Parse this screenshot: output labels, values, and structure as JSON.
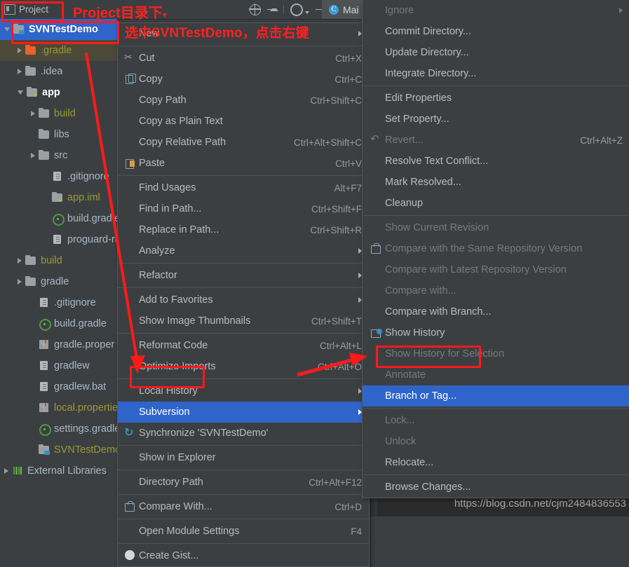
{
  "header": {
    "project_tab_label": "Project",
    "project_tab_icon": "project-tool-window-icon",
    "toolbar_icons": [
      "locate-target-icon",
      "collapse-all-icon",
      "settings-gear-icon",
      "hide-window-icon"
    ],
    "editor_tab_label": "Mai",
    "editor_tab_icon": "java-class-icon"
  },
  "annotations": {
    "title_note": "Project目录下",
    "title_caret": "▾",
    "select_note": "选中SVNTestDemo，点击右键",
    "boxes": [
      "project-tab",
      "svntestdemo-node",
      "subversion-item",
      "branch-or-tag-item"
    ],
    "color": "#ff1a1a"
  },
  "tree": {
    "items": [
      {
        "label": "SVNTestDemo",
        "indent": 0,
        "arrow": "down",
        "icon": "folder-module-svn-icon",
        "style": "root-selected"
      },
      {
        "label": ".gradle",
        "indent": 1,
        "arrow": "right",
        "icon": "folder-orange-icon",
        "style": "excluded"
      },
      {
        "label": ".idea",
        "indent": 1,
        "arrow": "right",
        "icon": "folder-grey-icon",
        "style": "normal"
      },
      {
        "label": "app",
        "indent": 1,
        "arrow": "down",
        "icon": "folder-module-icon",
        "style": "bold"
      },
      {
        "label": "build",
        "indent": 2,
        "arrow": "right",
        "icon": "folder-grey-icon",
        "style": "excluded"
      },
      {
        "label": "libs",
        "indent": 2,
        "arrow": "none",
        "icon": "folder-grey-icon",
        "style": "normal"
      },
      {
        "label": "src",
        "indent": 2,
        "arrow": "right",
        "icon": "folder-grey-icon",
        "style": "normal"
      },
      {
        "label": ".gitignore",
        "indent": 3,
        "arrow": "none",
        "icon": "file-text-icon",
        "style": "normal"
      },
      {
        "label": "app.iml",
        "indent": 3,
        "arrow": "none",
        "icon": "module-iml-icon",
        "style": "excluded"
      },
      {
        "label": "build.gradle",
        "indent": 3,
        "arrow": "none",
        "icon": "gradle-file-icon",
        "style": "normal"
      },
      {
        "label": "proguard-ru",
        "indent": 3,
        "arrow": "none",
        "icon": "file-text-icon",
        "style": "normal"
      },
      {
        "label": "build",
        "indent": 1,
        "arrow": "right",
        "icon": "folder-grey-icon",
        "style": "excluded"
      },
      {
        "label": "gradle",
        "indent": 1,
        "arrow": "right",
        "icon": "folder-grey-icon",
        "style": "normal"
      },
      {
        "label": ".gitignore",
        "indent": 2,
        "arrow": "none",
        "icon": "file-text-icon",
        "style": "normal"
      },
      {
        "label": "build.gradle",
        "indent": 2,
        "arrow": "none",
        "icon": "gradle-file-icon",
        "style": "normal"
      },
      {
        "label": "gradle.proper",
        "indent": 2,
        "arrow": "none",
        "icon": "properties-file-icon",
        "style": "normal"
      },
      {
        "label": "gradlew",
        "indent": 2,
        "arrow": "none",
        "icon": "file-text-icon",
        "style": "normal"
      },
      {
        "label": "gradlew.bat",
        "indent": 2,
        "arrow": "none",
        "icon": "file-text-icon",
        "style": "normal"
      },
      {
        "label": "local.propertie",
        "indent": 2,
        "arrow": "none",
        "icon": "properties-file-icon",
        "style": "excluded"
      },
      {
        "label": "settings.gradle",
        "indent": 2,
        "arrow": "none",
        "icon": "gradle-file-icon",
        "style": "normal"
      },
      {
        "label": "SVNTestDemo",
        "indent": 2,
        "arrow": "none",
        "icon": "folder-svn-icon",
        "style": "excluded"
      },
      {
        "label": "External Libraries",
        "indent": 0,
        "arrow": "right",
        "icon": "external-libraries-icon",
        "style": "normal"
      }
    ]
  },
  "context_menu": {
    "items": [
      {
        "label": "New",
        "accel": "",
        "icon": "",
        "submenu": true,
        "state": "normal"
      },
      {
        "sep": true
      },
      {
        "label": "Cut",
        "accel": "Ctrl+X",
        "icon": "cut-icon",
        "submenu": false,
        "state": "normal"
      },
      {
        "label": "Copy",
        "accel": "Ctrl+C",
        "icon": "copy-icon",
        "submenu": false,
        "state": "normal"
      },
      {
        "label": "Copy Path",
        "accel": "Ctrl+Shift+C",
        "icon": "",
        "submenu": false,
        "state": "normal"
      },
      {
        "label": "Copy as Plain Text",
        "accel": "",
        "icon": "",
        "submenu": false,
        "state": "normal"
      },
      {
        "label": "Copy Relative Path",
        "accel": "Ctrl+Alt+Shift+C",
        "icon": "",
        "submenu": false,
        "state": "normal"
      },
      {
        "label": "Paste",
        "accel": "Ctrl+V",
        "icon": "paste-icon",
        "submenu": false,
        "state": "normal"
      },
      {
        "sep": true
      },
      {
        "label": "Find Usages",
        "accel": "Alt+F7",
        "icon": "",
        "submenu": false,
        "state": "normal"
      },
      {
        "label": "Find in Path...",
        "accel": "Ctrl+Shift+F",
        "icon": "",
        "submenu": false,
        "state": "normal"
      },
      {
        "label": "Replace in Path...",
        "accel": "Ctrl+Shift+R",
        "icon": "",
        "submenu": false,
        "state": "normal"
      },
      {
        "label": "Analyze",
        "accel": "",
        "icon": "",
        "submenu": true,
        "state": "normal"
      },
      {
        "sep": true
      },
      {
        "label": "Refactor",
        "accel": "",
        "icon": "",
        "submenu": true,
        "state": "normal"
      },
      {
        "sep": true
      },
      {
        "label": "Add to Favorites",
        "accel": "",
        "icon": "",
        "submenu": true,
        "state": "normal"
      },
      {
        "label": "Show Image Thumbnails",
        "accel": "Ctrl+Shift+T",
        "icon": "",
        "submenu": false,
        "state": "normal"
      },
      {
        "sep": true
      },
      {
        "label": "Reformat Code",
        "accel": "Ctrl+Alt+L",
        "icon": "",
        "submenu": false,
        "state": "normal"
      },
      {
        "label": "Optimize Imports",
        "accel": "Ctrl+Alt+O",
        "icon": "",
        "submenu": false,
        "state": "normal"
      },
      {
        "sep": true
      },
      {
        "label": "Local History",
        "accel": "",
        "icon": "",
        "submenu": true,
        "state": "normal"
      },
      {
        "label": "Subversion",
        "accel": "",
        "icon": "",
        "submenu": true,
        "state": "selected"
      },
      {
        "label": "Synchronize 'SVNTestDemo'",
        "accel": "",
        "icon": "synchronize-icon",
        "submenu": false,
        "state": "normal"
      },
      {
        "sep": true
      },
      {
        "label": "Show in Explorer",
        "accel": "",
        "icon": "",
        "submenu": false,
        "state": "normal"
      },
      {
        "sep": true
      },
      {
        "label": "Directory Path",
        "accel": "Ctrl+Alt+F12",
        "icon": "",
        "submenu": false,
        "state": "normal"
      },
      {
        "sep": true
      },
      {
        "label": "Compare With...",
        "accel": "Ctrl+D",
        "icon": "compare-icon",
        "submenu": false,
        "state": "normal"
      },
      {
        "sep": true
      },
      {
        "label": "Open Module Settings",
        "accel": "F4",
        "icon": "",
        "submenu": false,
        "state": "normal"
      },
      {
        "sep": true
      },
      {
        "label": "Create Gist...",
        "accel": "",
        "icon": "github-icon",
        "submenu": false,
        "state": "normal"
      }
    ]
  },
  "submenu": {
    "title": "Subversion",
    "items": [
      {
        "label": "Ignore",
        "accel": "",
        "icon": "",
        "submenu": true,
        "state": "disabled"
      },
      {
        "label": "Commit Directory...",
        "accel": "",
        "icon": "",
        "submenu": false,
        "state": "normal"
      },
      {
        "label": "Update Directory...",
        "accel": "",
        "icon": "",
        "submenu": false,
        "state": "normal"
      },
      {
        "label": "Integrate Directory...",
        "accel": "",
        "icon": "",
        "submenu": false,
        "state": "normal"
      },
      {
        "sep": true
      },
      {
        "label": "Edit Properties",
        "accel": "",
        "icon": "",
        "submenu": false,
        "state": "normal"
      },
      {
        "label": "Set Property...",
        "accel": "",
        "icon": "",
        "submenu": false,
        "state": "normal"
      },
      {
        "label": "Revert...",
        "accel": "Ctrl+Alt+Z",
        "icon": "revert-icon",
        "submenu": false,
        "state": "disabled"
      },
      {
        "label": "Resolve Text Conflict...",
        "accel": "",
        "icon": "",
        "submenu": false,
        "state": "normal"
      },
      {
        "label": "Mark Resolved...",
        "accel": "",
        "icon": "",
        "submenu": false,
        "state": "normal"
      },
      {
        "label": "Cleanup",
        "accel": "",
        "icon": "",
        "submenu": false,
        "state": "normal"
      },
      {
        "sep": true
      },
      {
        "label": "Show Current Revision",
        "accel": "",
        "icon": "",
        "submenu": false,
        "state": "disabled"
      },
      {
        "label": "Compare with the Same Repository Version",
        "accel": "",
        "icon": "compare-icon",
        "submenu": false,
        "state": "disabled"
      },
      {
        "label": "Compare with Latest Repository Version",
        "accel": "",
        "icon": "",
        "submenu": false,
        "state": "disabled"
      },
      {
        "label": "Compare with...",
        "accel": "",
        "icon": "",
        "submenu": false,
        "state": "disabled"
      },
      {
        "label": "Compare with Branch...",
        "accel": "",
        "icon": "",
        "submenu": false,
        "state": "normal"
      },
      {
        "label": "Show History",
        "accel": "",
        "icon": "history-icon",
        "submenu": false,
        "state": "normal"
      },
      {
        "label": "Show History for Selection",
        "accel": "",
        "icon": "",
        "submenu": false,
        "state": "disabled"
      },
      {
        "label": "Annotate",
        "accel": "",
        "icon": "",
        "submenu": false,
        "state": "disabled"
      },
      {
        "label": "Branch or Tag...",
        "accel": "",
        "icon": "",
        "submenu": false,
        "state": "selected"
      },
      {
        "sep": true
      },
      {
        "label": "Lock...",
        "accel": "",
        "icon": "",
        "submenu": false,
        "state": "disabled"
      },
      {
        "label": "Unlock",
        "accel": "",
        "icon": "",
        "submenu": false,
        "state": "disabled"
      },
      {
        "label": "Relocate...",
        "accel": "",
        "icon": "",
        "submenu": false,
        "state": "normal"
      },
      {
        "sep": true
      },
      {
        "label": "Browse Changes...",
        "accel": "",
        "icon": "",
        "submenu": false,
        "state": "normal"
      }
    ]
  },
  "editor": {
    "watermark": "https://blog.csdn.net/cjm2484836553"
  }
}
